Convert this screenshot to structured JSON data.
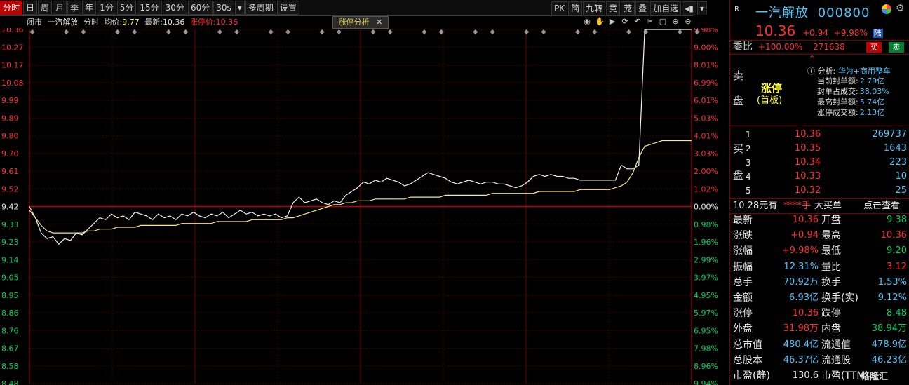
{
  "toolbar": {
    "tabs": [
      "分时",
      "日",
      "周",
      "月",
      "季",
      "年",
      "1分",
      "5分",
      "15分",
      "30分",
      "60分",
      "30s",
      "▾",
      "多周期",
      "设置"
    ],
    "right_tabs": [
      "PK",
      "简",
      "九转",
      "竞",
      "茏",
      "叠",
      "加自选"
    ],
    "right_icons": [
      "◂▮",
      "▾"
    ]
  },
  "infobar": {
    "state": "闭市",
    "stock_name": "一汽解放",
    "mode": "分时",
    "avg_label": "均价:",
    "avg_value": "9.77",
    "latest_label": "最新:",
    "latest_value": "10.36",
    "limit_label": "涨停价:",
    "limit_value": "10.36",
    "limit_button": "涨停分析",
    "close_x": "✕"
  },
  "chart_data": {
    "type": "line",
    "prev_close": 9.42,
    "y_price_ticks": [
      "10.36",
      "10.27",
      "10.17",
      "10.08",
      "9.99",
      "9.89",
      "9.80",
      "9.70",
      "9.61",
      "9.52",
      "9.42",
      "9.33",
      "9.23",
      "9.14",
      "9.05",
      "8.95",
      "8.86",
      "8.76",
      "8.67",
      "8.58",
      "8.48"
    ],
    "y_pct_ticks": [
      "9.98%",
      "9.00%",
      "8.01%",
      "6.99%",
      "6.01%",
      "5.03%",
      "4.01%",
      "3.03%",
      "2.00%",
      "1.02%",
      "0.00%",
      "0.98%",
      "1.96%",
      "2.99%",
      "3.97%",
      "4.95%",
      "5.97%",
      "6.95%",
      "7.98%",
      "8.96%",
      "9.94%"
    ],
    "ylim": [
      8.48,
      10.36
    ],
    "price_series": [
      9.4,
      9.36,
      9.28,
      9.25,
      9.26,
      9.22,
      9.25,
      9.24,
      9.28,
      9.27,
      9.3,
      9.33,
      9.36,
      9.35,
      9.38,
      9.36,
      9.37,
      9.35,
      9.39,
      9.38,
      9.37,
      9.35,
      9.38,
      9.36,
      9.37,
      9.35,
      9.38,
      9.37,
      9.39,
      9.37,
      9.36,
      9.38,
      9.37,
      9.39,
      9.36,
      9.38,
      9.4,
      9.38,
      9.39,
      9.37,
      9.38,
      9.37,
      9.38,
      9.36,
      9.37,
      9.44,
      9.47,
      9.44,
      9.45,
      9.46,
      9.44,
      9.43,
      9.45,
      9.44,
      9.48,
      9.5,
      9.52,
      9.55,
      9.54,
      9.56,
      9.55,
      9.57,
      9.56,
      9.55,
      9.53,
      9.54,
      9.56,
      9.58,
      9.6,
      9.59,
      9.58,
      9.57,
      9.55,
      9.54,
      9.55,
      9.56,
      9.55,
      9.54,
      9.55,
      9.55,
      9.54,
      9.54,
      9.53,
      9.52,
      9.53,
      9.55,
      9.58,
      9.59,
      9.58,
      9.59,
      9.58,
      9.58,
      9.57,
      9.57,
      9.56,
      9.56,
      9.56,
      9.56,
      9.56,
      9.56,
      9.56,
      9.64,
      9.62,
      9.62,
      9.64,
      10.36,
      10.36,
      10.36,
      10.36,
      10.36,
      10.36,
      10.36,
      10.36,
      10.36
    ],
    "avg_series": [
      9.42,
      9.36,
      9.32,
      9.29,
      9.28,
      9.28,
      9.28,
      9.28,
      9.28,
      9.28,
      9.29,
      9.29,
      9.3,
      9.3,
      9.3,
      9.31,
      9.31,
      9.31,
      9.31,
      9.32,
      9.32,
      9.32,
      9.32,
      9.32,
      9.32,
      9.32,
      9.33,
      9.33,
      9.33,
      9.33,
      9.33,
      9.33,
      9.34,
      9.34,
      9.34,
      9.34,
      9.34,
      9.34,
      9.35,
      9.35,
      9.35,
      9.35,
      9.35,
      9.35,
      9.36,
      9.36,
      9.37,
      9.38,
      9.39,
      9.4,
      9.41,
      9.42,
      9.43,
      9.43,
      9.44,
      9.44,
      9.45,
      9.45,
      9.45,
      9.46,
      9.46,
      9.46,
      9.46,
      9.46,
      9.46,
      9.47,
      9.47,
      9.47,
      9.47,
      9.47,
      9.47,
      9.48,
      9.48,
      9.48,
      9.48,
      9.48,
      9.48,
      9.48,
      9.48,
      9.49,
      9.49,
      9.49,
      9.49,
      9.49,
      9.49,
      9.49,
      9.49,
      9.5,
      9.5,
      9.5,
      9.5,
      9.5,
      9.5,
      9.5,
      9.51,
      9.51,
      9.51,
      9.51,
      9.51,
      9.51,
      9.52,
      9.53,
      9.55,
      9.6,
      9.68,
      9.74,
      9.75,
      9.76,
      9.77,
      9.77,
      9.77,
      9.77,
      9.77,
      9.77
    ]
  },
  "right": {
    "stock_name": "一汽解放",
    "code": "000800",
    "price": "10.36",
    "change": "+0.94",
    "change_pct": "+9.98%",
    "badge": "陆",
    "weibi_label": "委比",
    "weibi_value": "+100.00%",
    "weibi_amount": "271638",
    "buy_btn": "买",
    "sell_btn": "卖",
    "sell_side_label": "卖",
    "sell_side_label2": "盘",
    "limit_title": "涨停",
    "limit_sub": "(首板)",
    "analysis_label": "分析:",
    "analysis_value": "华为+商用整车",
    "stats": [
      {
        "label": "当前封单额:",
        "value": "2.79亿"
      },
      {
        "label": "封单占成交:",
        "value": "38.03%"
      },
      {
        "label": "最高封单额:",
        "value": "5.74亿"
      },
      {
        "label": "涨停成交额:",
        "value": "2.13亿"
      }
    ],
    "buy_side_label": "买",
    "buy_side_label2": "盘",
    "bids": [
      {
        "n": "1",
        "price": "10.36",
        "vol": "269737"
      },
      {
        "n": "2",
        "price": "10.35",
        "vol": "1643"
      },
      {
        "n": "3",
        "price": "10.34",
        "vol": "223"
      },
      {
        "n": "4",
        "price": "10.33",
        "vol": "10"
      },
      {
        "n": "5",
        "price": "10.32",
        "vol": "25"
      }
    ],
    "bigbuy_line": [
      "10.28元有",
      "****手",
      "大买单",
      "点击查看"
    ],
    "quotes": [
      {
        "l": "最新",
        "v": "10.36",
        "c": "red",
        "l2": "开盘",
        "v2": "9.38",
        "c2": "green"
      },
      {
        "l": "涨跌",
        "v": "+0.94",
        "c": "red",
        "l2": "最高",
        "v2": "10.36",
        "c2": "red"
      },
      {
        "l": "涨幅",
        "v": "+9.98%",
        "c": "red",
        "l2": "最低",
        "v2": "9.20",
        "c2": "green"
      },
      {
        "l": "振幅",
        "v": "12.31%",
        "c": "cyan",
        "l2": "量比",
        "v2": "3.12",
        "c2": "red"
      },
      {
        "l": "总手",
        "v": "70.92万",
        "c": "cyan",
        "l2": "换手",
        "v2": "1.53%",
        "c2": "cyan"
      },
      {
        "l": "金额",
        "v": "6.93亿",
        "c": "cyan",
        "l2": "换手(实)",
        "v2": "9.12%",
        "c2": "cyan"
      },
      {
        "l": "涨停",
        "v": "10.36",
        "c": "red",
        "l2": "跌停",
        "v2": "8.48",
        "c2": "green"
      },
      {
        "l": "外盘",
        "v": "31.98万",
        "c": "red",
        "l2": "内盘",
        "v2": "38.94万",
        "c2": "green"
      },
      {
        "l": "总市值",
        "v": "480.4亿",
        "c": "cyan",
        "l2": "流通值",
        "v2": "478.9亿",
        "c2": "cyan"
      },
      {
        "l": "总股本",
        "v": "46.37亿",
        "c": "cyan",
        "l2": "流通股",
        "v2": "46.23亿",
        "c2": "cyan"
      },
      {
        "l": "市盈(静)",
        "v": "130.6",
        "c": "white",
        "l2": "市盈(TTM)",
        "v2": "",
        "c2": "white"
      }
    ],
    "watermark": "格隆汇"
  }
}
